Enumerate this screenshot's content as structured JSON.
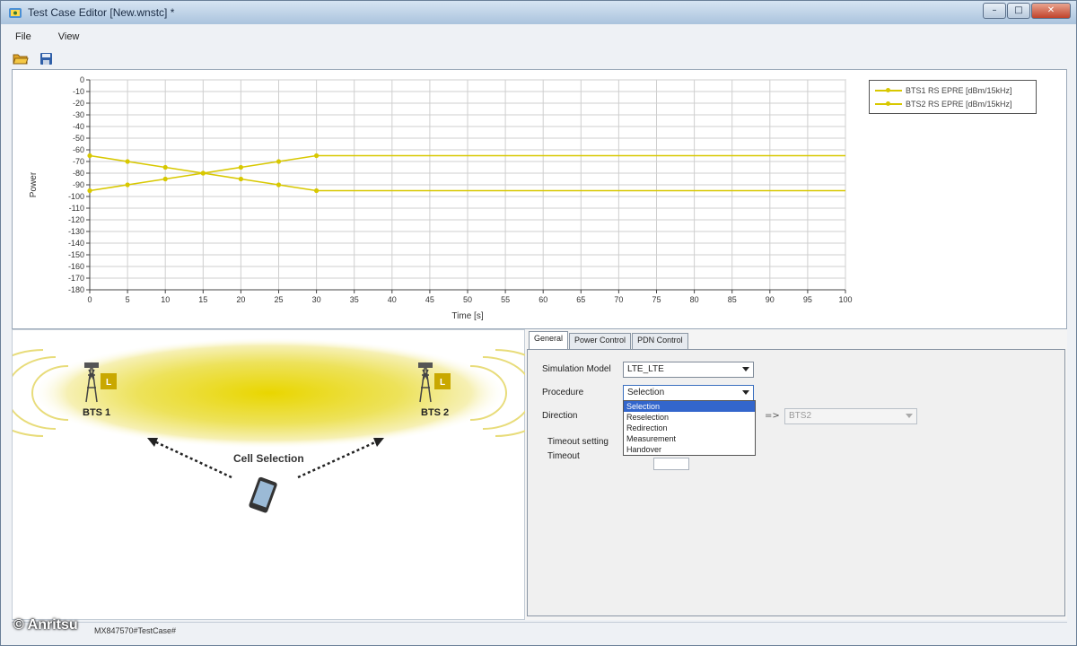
{
  "window": {
    "title": "Test Case Editor [New.wnstc] *"
  },
  "menu": {
    "items": [
      "File",
      "View"
    ]
  },
  "toolbar": {
    "open_icon": "folder-open-icon",
    "save_icon": "floppy-disk-icon"
  },
  "chart_data": {
    "type": "line",
    "xlabel": "Time [s]",
    "ylabel": "Power",
    "xlim": [
      0,
      100
    ],
    "ylim": [
      -180,
      0
    ],
    "x_ticks": [
      0,
      5,
      10,
      15,
      20,
      25,
      30,
      35,
      40,
      45,
      50,
      55,
      60,
      65,
      70,
      75,
      80,
      85,
      90,
      95,
      100
    ],
    "y_ticks": [
      0,
      -10,
      -20,
      -30,
      -40,
      -50,
      -60,
      -70,
      -80,
      -90,
      -100,
      -110,
      -120,
      -130,
      -140,
      -150,
      -160,
      -170,
      -180
    ],
    "grid": true,
    "legend_position": "top-right",
    "series": [
      {
        "name": "BTS1 RS EPRE [dBm/15kHz]",
        "color": "#d8c800",
        "x": [
          0,
          5,
          10,
          15,
          20,
          25,
          30,
          100
        ],
        "y": [
          -65,
          -70,
          -75,
          -80,
          -85,
          -90,
          -95,
          -95
        ]
      },
      {
        "name": "BTS2 RS EPRE [dBm/15kHz]",
        "color": "#d8c800",
        "x": [
          0,
          5,
          10,
          15,
          20,
          25,
          30,
          100
        ],
        "y": [
          -95,
          -90,
          -85,
          -80,
          -75,
          -70,
          -65,
          -65
        ]
      }
    ]
  },
  "scene": {
    "bts1_label": "BTS 1",
    "bts2_label": "BTS 2",
    "badge_letter": "L",
    "caption": "Cell Selection"
  },
  "config": {
    "tabs": [
      "General",
      "Power Control",
      "PDN Control"
    ],
    "simulation_model_label": "Simulation Model",
    "simulation_model_value": "LTE_LTE",
    "procedure_label": "Procedure",
    "procedure_value": "Selection",
    "procedure_options": [
      "Selection",
      "Reselection",
      "Redirection",
      "Measurement",
      "Handover"
    ],
    "direction_label": "Direction",
    "direction_arrow": "=>",
    "direction_target": "BTS2",
    "timeout_setting_label": "Timeout setting",
    "timeout_label": "Timeout"
  },
  "status": {
    "text": "MX847570#TestCase#"
  },
  "watermark": "© Anritsu"
}
